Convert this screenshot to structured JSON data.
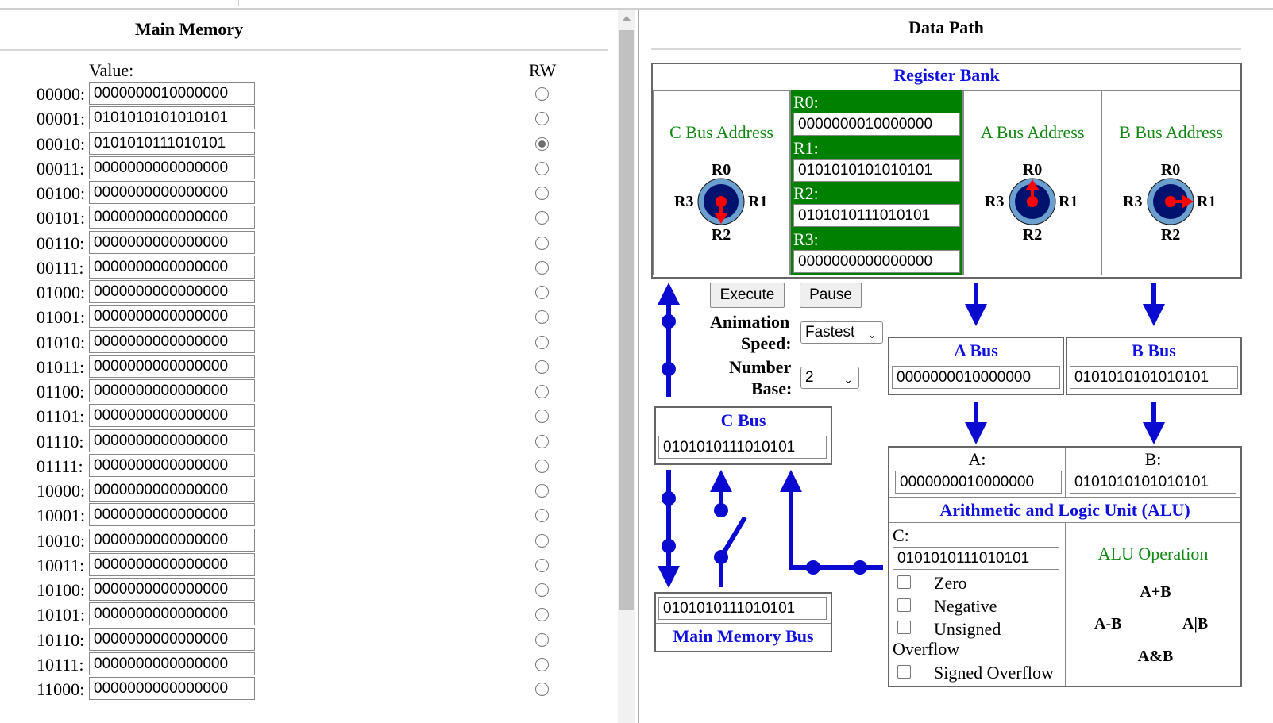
{
  "memory": {
    "title": "Main Memory",
    "value_label": "Value:",
    "rw_label": "RW",
    "rows": [
      {
        "addr": "00000:",
        "value": "0000000010000000",
        "selected": false
      },
      {
        "addr": "00001:",
        "value": "0101010101010101",
        "selected": false
      },
      {
        "addr": "00010:",
        "value": "0101010111010101",
        "selected": true
      },
      {
        "addr": "00011:",
        "value": "0000000000000000",
        "selected": false
      },
      {
        "addr": "00100:",
        "value": "0000000000000000",
        "selected": false
      },
      {
        "addr": "00101:",
        "value": "0000000000000000",
        "selected": false
      },
      {
        "addr": "00110:",
        "value": "0000000000000000",
        "selected": false
      },
      {
        "addr": "00111:",
        "value": "0000000000000000",
        "selected": false
      },
      {
        "addr": "01000:",
        "value": "0000000000000000",
        "selected": false
      },
      {
        "addr": "01001:",
        "value": "0000000000000000",
        "selected": false
      },
      {
        "addr": "01010:",
        "value": "0000000000000000",
        "selected": false
      },
      {
        "addr": "01011:",
        "value": "0000000000000000",
        "selected": false
      },
      {
        "addr": "01100:",
        "value": "0000000000000000",
        "selected": false
      },
      {
        "addr": "01101:",
        "value": "0000000000000000",
        "selected": false
      },
      {
        "addr": "01110:",
        "value": "0000000000000000",
        "selected": false
      },
      {
        "addr": "01111:",
        "value": "0000000000000000",
        "selected": false
      },
      {
        "addr": "10000:",
        "value": "0000000000000000",
        "selected": false
      },
      {
        "addr": "10001:",
        "value": "0000000000000000",
        "selected": false
      },
      {
        "addr": "10010:",
        "value": "0000000000000000",
        "selected": false
      },
      {
        "addr": "10011:",
        "value": "0000000000000000",
        "selected": false
      },
      {
        "addr": "10100:",
        "value": "0000000000000000",
        "selected": false
      },
      {
        "addr": "10101:",
        "value": "0000000000000000",
        "selected": false
      },
      {
        "addr": "10110:",
        "value": "0000000000000000",
        "selected": false
      },
      {
        "addr": "10111:",
        "value": "0000000000000000",
        "selected": false
      },
      {
        "addr": "11000:",
        "value": "0000000000000000",
        "selected": false
      }
    ]
  },
  "datapath": {
    "title": "Data Path",
    "register_bank": {
      "title": "Register Bank",
      "c_bus_address": "C Bus Address",
      "a_bus_address": "A Bus Address",
      "b_bus_address": "B Bus Address",
      "dial_labels": {
        "top": "R0",
        "right": "R1",
        "bottom": "R2",
        "left": "R3"
      },
      "registers": [
        {
          "label": "R0:",
          "value": "0000000010000000"
        },
        {
          "label": "R1:",
          "value": "0101010101010101"
        },
        {
          "label": "R2:",
          "value": "0101010111010101"
        },
        {
          "label": "R3:",
          "value": "0000000000000000"
        }
      ]
    },
    "controls": {
      "execute": "Execute",
      "pause": "Pause",
      "animation_label_1": "Animation",
      "animation_label_2": "Speed:",
      "animation_value": "Fastest",
      "base_label_1": "Number",
      "base_label_2": "Base:",
      "base_value": "2"
    },
    "a_bus": {
      "title": "A Bus",
      "value": "0000000010000000"
    },
    "b_bus": {
      "title": "B Bus",
      "value": "0101010101010101"
    },
    "c_bus": {
      "title": "C Bus",
      "value": "0101010111010101"
    },
    "main_memory_bus": {
      "title": "Main Memory Bus",
      "value": "0101010111010101"
    },
    "alu": {
      "a_label": "A:",
      "a_value": "0000000010000000",
      "b_label": "B:",
      "b_value": "0101010101010101",
      "title": "Arithmetic and Logic Unit (ALU)",
      "c_label": "C:",
      "c_value": "0101010111010101",
      "flags": [
        "Zero",
        "Negative",
        "Unsigned",
        "Signed Overflow"
      ],
      "overflow_word": "Overflow",
      "operation_title": "ALU Operation",
      "op_labels": {
        "top": "A+B",
        "right": "A|B",
        "bottom": "A&B",
        "left": "A-B"
      }
    },
    "colors": {
      "accent_blue": "#1010e0",
      "register_green": "#008000",
      "label_green": "#108810",
      "bus_blue": "#0000cc",
      "pointer_red": "#ff0000"
    }
  }
}
